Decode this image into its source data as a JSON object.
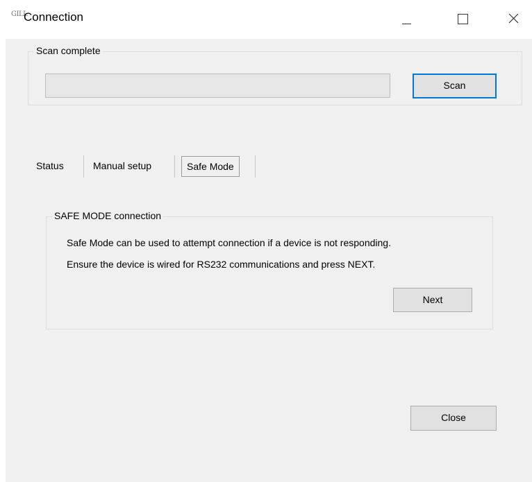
{
  "window": {
    "icon_text": "GILL",
    "title": "Connection"
  },
  "scan": {
    "group_label": "Scan complete",
    "progress": 0,
    "scan_button": "Scan"
  },
  "tabs": [
    {
      "label": "Status",
      "selected": false
    },
    {
      "label": "Manual setup",
      "selected": false
    },
    {
      "label": "Safe Mode",
      "selected": true
    }
  ],
  "safe_mode": {
    "group_label": "SAFE MODE connection",
    "line1": "Safe Mode can be used to attempt connection if a device is not responding.",
    "line2": "Ensure the device is wired for RS232 communications and press NEXT.",
    "next_button": "Next"
  },
  "footer": {
    "close_button": "Close"
  },
  "colors": {
    "client_bg": "#f0f0f0",
    "focus_border": "#0078d7"
  }
}
